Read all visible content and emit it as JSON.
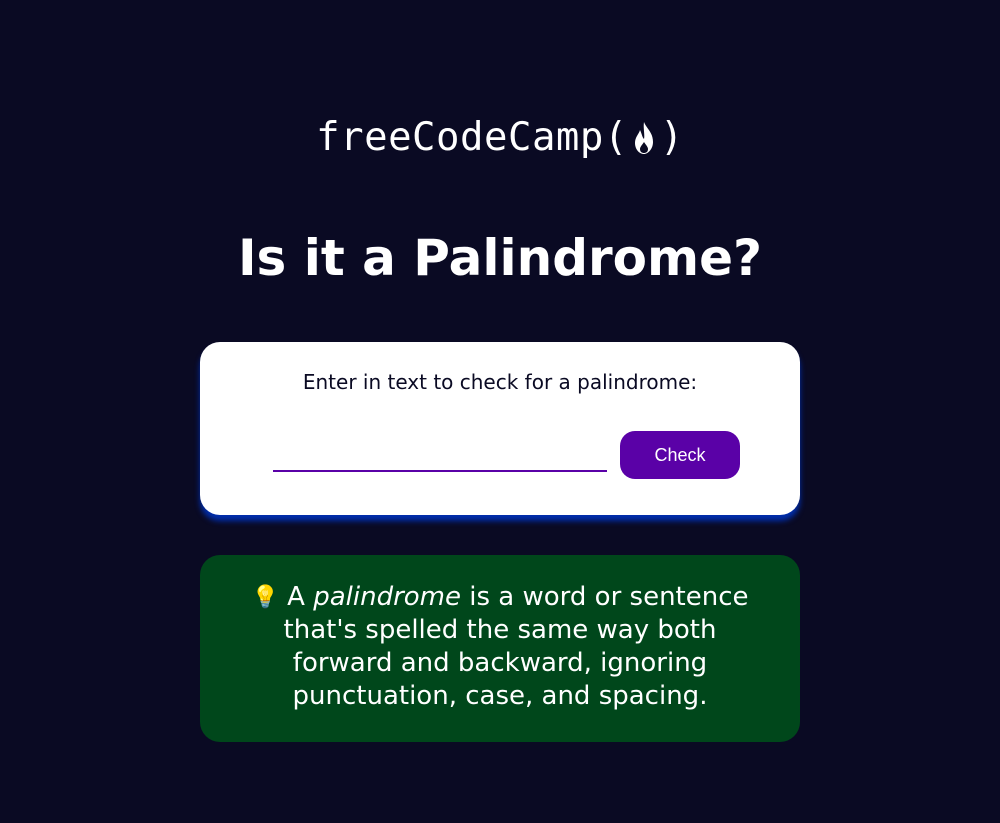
{
  "logo": {
    "text_before": "freeCodeCamp(",
    "text_after": ")",
    "flame_icon": "flame-icon"
  },
  "title": "Is it a Palindrome?",
  "input_card": {
    "label": "Enter in text to check for a palindrome:",
    "input_value": "",
    "button_label": "Check"
  },
  "info": {
    "bulb_icon": "💡",
    "prefix": " A ",
    "term": "palindrome",
    "definition": " is a word or sentence that's spelled the same way both forward and backward, ignoring punctuation, case, and spacing."
  },
  "colors": {
    "background": "#0a0a23",
    "button": "#5a01a7",
    "info_box": "#00471b",
    "card_shadow": "#002ead"
  }
}
